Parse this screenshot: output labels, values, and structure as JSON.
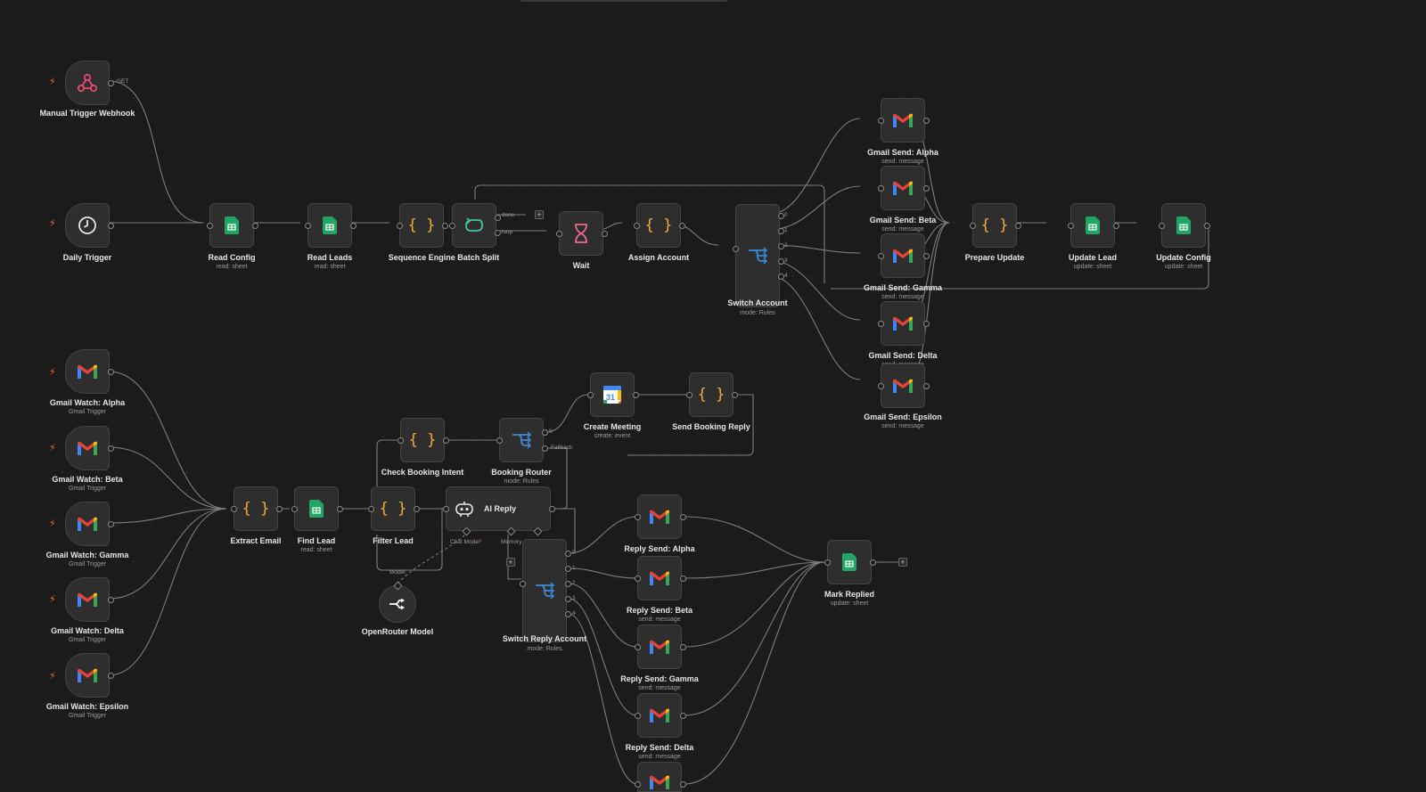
{
  "canvas": {
    "background": "#1b1b1b",
    "accent_trigger": "#f06a2a",
    "accent_code": "#f4a93a",
    "accent_sheet": "#21a464",
    "accent_switch": "#3b8bd9",
    "accent_loop": "#44c4a4"
  },
  "nodes": {
    "manual_trigger": {
      "label": "Manual Trigger Webhook",
      "port_label": "GET",
      "icon": "webhook-icon"
    },
    "daily_trigger": {
      "label": "Daily Trigger",
      "icon": "clock-icon"
    },
    "read_config": {
      "label": "Read Config",
      "sub": "read: sheet",
      "icon": "sheets-icon"
    },
    "read_leads": {
      "label": "Read Leads",
      "sub": "read: sheet",
      "icon": "sheets-icon"
    },
    "batch_split": {
      "label": "Sequence Engine Batch Split",
      "icon": "code-icon"
    },
    "loop": {
      "port_done": "done",
      "port_loop": "loop",
      "icon": "loop-icon"
    },
    "wait": {
      "label": "Wait",
      "icon": "hourglass-icon"
    },
    "assign_account": {
      "label": "Assign Account",
      "icon": "code-icon"
    },
    "switch_account": {
      "label": "Switch Account",
      "sub": "mode: Rules",
      "ports": [
        "0",
        "1",
        "2",
        "3",
        "4"
      ],
      "icon": "switch-icon"
    },
    "gmail_send_alpha": {
      "label": "Gmail Send: Alpha",
      "sub": "send: message"
    },
    "gmail_send_beta": {
      "label": "Gmail Send: Beta",
      "sub": "send: message"
    },
    "gmail_send_gamma": {
      "label": "Gmail Send: Gamma",
      "sub": "send: message"
    },
    "gmail_send_delta": {
      "label": "Gmail Send: Delta",
      "sub": "send: message"
    },
    "gmail_send_epsilon": {
      "label": "Gmail Send: Epsilon",
      "sub": "send: message"
    },
    "prepare_update": {
      "label": "Prepare Update",
      "icon": "code-icon"
    },
    "update_lead": {
      "label": "Update Lead",
      "sub": "update: sheet",
      "icon": "sheets-icon"
    },
    "update_config": {
      "label": "Update Config",
      "sub": "update: sheet",
      "icon": "sheets-icon"
    },
    "watch_alpha": {
      "label": "Gmail Watch: Alpha",
      "sub": "Gmail Trigger"
    },
    "watch_beta": {
      "label": "Gmail Watch: Beta",
      "sub": "Gmail Trigger"
    },
    "watch_gamma": {
      "label": "Gmail Watch: Gamma",
      "sub": "Gmail Trigger"
    },
    "watch_delta": {
      "label": "Gmail Watch: Delta",
      "sub": "Gmail Trigger"
    },
    "watch_epsilon": {
      "label": "Gmail Watch: Epsilon",
      "sub": "Gmail Trigger"
    },
    "extract_email": {
      "label": "Extract Email",
      "icon": "code-icon"
    },
    "find_lead": {
      "label": "Find Lead",
      "sub": "read: sheet",
      "icon": "sheets-icon"
    },
    "filter_lead": {
      "label": "Filter Lead",
      "icon": "code-icon"
    },
    "check_booking": {
      "label": "Check Booking Intent",
      "icon": "code-icon"
    },
    "booking_router": {
      "label": "Booking Router",
      "sub": "mode: Rules",
      "port_0": "0",
      "port_fallback": "Fallback",
      "icon": "switch-icon"
    },
    "create_meeting": {
      "label": "Create Meeting",
      "sub": "create: event",
      "icon": "calendar-icon",
      "calendar_day": "31"
    },
    "send_booking_reply": {
      "label": "Send Booking Reply",
      "icon": "code-icon"
    },
    "ai_reply": {
      "label": "AI Reply",
      "port_chat_model": "Chat Model",
      "port_required": "*",
      "port_memory": "Memory",
      "icon": "robot-icon"
    },
    "openrouter": {
      "label": "OpenRouter Model",
      "port_label": "Model",
      "icon": "openrouter-icon"
    },
    "switch_reply": {
      "label": "Switch Reply Account",
      "sub": "mode: Rules",
      "ports": [
        "0",
        "1",
        "2",
        "3",
        "4"
      ],
      "icon": "switch-icon"
    },
    "reply_alpha": {
      "label": "Reply Send: Alpha"
    },
    "reply_beta": {
      "label": "Reply Send: Beta",
      "sub": "send: message"
    },
    "reply_gamma": {
      "label": "Reply Send: Gamma",
      "sub": "send: message"
    },
    "reply_delta": {
      "label": "Reply Send: Delta",
      "sub": "send: message"
    },
    "mark_replied": {
      "label": "Mark Replied",
      "sub": "update: sheet",
      "icon": "sheets-icon"
    }
  },
  "controls": {
    "add_label": "+"
  },
  "glyphs": {
    "bolt": "⚡",
    "code": "{ }"
  }
}
